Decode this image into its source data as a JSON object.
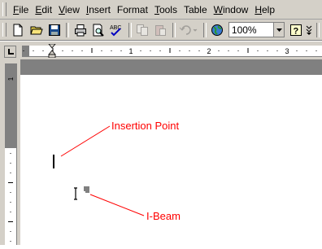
{
  "menubar": {
    "items": [
      {
        "key": "F",
        "rest": "ile"
      },
      {
        "key": "E",
        "rest": "dit"
      },
      {
        "key": "V",
        "rest": "iew"
      },
      {
        "key": "I",
        "rest": "nsert"
      },
      {
        "key": "F",
        "rest": "ormat",
        "pre": ""
      },
      {
        "key": "T",
        "rest": "ools"
      },
      {
        "key": "T",
        "rest": "able",
        "pre": ""
      },
      {
        "key": "W",
        "rest": "indow"
      },
      {
        "key": "H",
        "rest": "elp"
      }
    ]
  },
  "toolbar": {
    "zoom_value": "100%",
    "icons": [
      "new-document-icon",
      "open-folder-icon",
      "save-icon",
      "print-icon",
      "print-preview-icon",
      "spelling-icon",
      "copy-icon",
      "paste-icon",
      "undo-icon",
      "web-toolbar-icon",
      "help-icon"
    ]
  },
  "ruler": {
    "numbers": [
      "1",
      "2",
      "3"
    ]
  },
  "annotations": {
    "insertion_point": "Insertion Point",
    "i_beam": "I-Beam"
  },
  "colors": {
    "chrome": "#d4d0c8",
    "annotation": "#ff0000",
    "ruler_gray": "#808080"
  }
}
